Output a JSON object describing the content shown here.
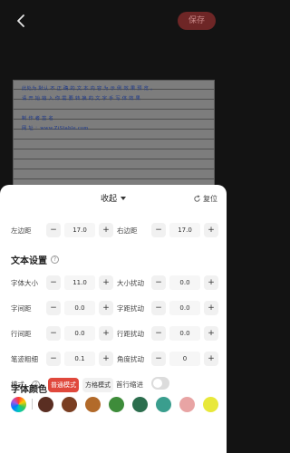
{
  "header": {
    "save_label": "保存"
  },
  "preview": {
    "lines": [
      "此处为 默认 不 正 确 的 文 本 内 容 为 示 例 效 果 预 览 。",
      "请 开 始 输 入 你 需 要 转 换 的 文 字 手 写 体 效 果",
      "制 作 者 签 名",
      "网 址 ：www.ZiStable.com"
    ]
  },
  "panel": {
    "collapse_label": "收起",
    "reset_label": "复位",
    "margins": {
      "left_label": "左边距",
      "left_value": "17.0",
      "right_label": "右边距",
      "right_value": "17.0"
    },
    "text_settings": {
      "title": "文本设置",
      "font_size_label": "字体大小",
      "font_size_value": "11.0",
      "size_jitter_label": "大小扰动",
      "size_jitter_value": "0.0",
      "char_spacing_label": "字间距",
      "char_spacing_value": "0.0",
      "char_jitter_label": "字距扰动",
      "char_jitter_value": "0.0",
      "line_spacing_label": "行间距",
      "line_spacing_value": "0.0",
      "line_jitter_label": "行距扰动",
      "line_jitter_value": "0.0",
      "stroke_label": "笔迹粗细",
      "stroke_value": "0.1",
      "angle_jitter_label": "角度扰动",
      "angle_jitter_value": "0"
    },
    "mode": {
      "label": "模式",
      "normal_label": "普通模式",
      "grid_label": "方格模式",
      "indent_label": "首行缩进",
      "indent_on": false
    },
    "font_color": {
      "title": "字体颜色",
      "swatches": [
        "#5a2e22",
        "#7a3e22",
        "#b26a2a",
        "#3e8c3a",
        "#2c6e4e",
        "#3a9e8e",
        "#e8a4a4",
        "#e8e83a"
      ]
    },
    "minus": "−",
    "plus": "+"
  }
}
